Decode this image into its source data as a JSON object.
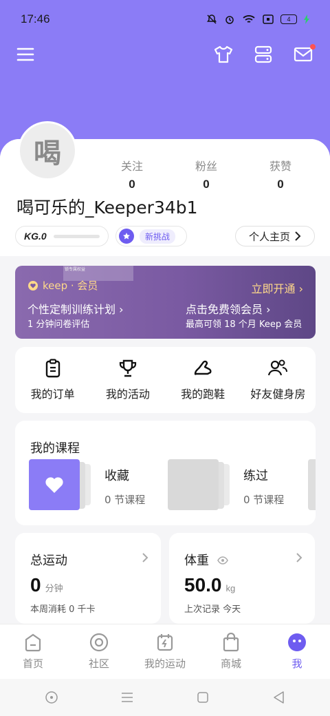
{
  "status": {
    "time": "17:46",
    "battery": "4"
  },
  "profile": {
    "avatar_char": "喝",
    "username": "喝可乐的_Keeper34b1",
    "stats": [
      {
        "label": "关注",
        "value": "0"
      },
      {
        "label": "粉丝",
        "value": "0"
      },
      {
        "label": "获赞",
        "value": "0"
      }
    ],
    "kg_level": "KG.0",
    "challenge_label": "新挑战",
    "home_button": "个人主页"
  },
  "vip": {
    "brand": "keep · 会员",
    "open_label": "立即开通",
    "item1_title": "个性定制训练计划",
    "item1_sub": "1 分钟问卷评估",
    "item2_title": "点击免费领会员",
    "item2_sub": "最高可领 18 个月 Keep 会员",
    "watermark": "这是提示中的内容，会员可提升并解锁专属权益"
  },
  "quick_links": [
    {
      "label": "我的订单",
      "icon": "clipboard-icon"
    },
    {
      "label": "我的活动",
      "icon": "trophy-icon"
    },
    {
      "label": "我的跑鞋",
      "icon": "shoe-icon"
    },
    {
      "label": "好友健身房",
      "icon": "friends-icon"
    }
  ],
  "courses": {
    "title": "我的课程",
    "items": [
      {
        "name": "收藏",
        "count": "0 节课程"
      },
      {
        "name": "练过",
        "count": "0 节课程"
      }
    ]
  },
  "total_exercise": {
    "title": "总运动",
    "value": "0",
    "unit": "分钟",
    "sub": "本周消耗 0 千卡"
  },
  "weight": {
    "title": "体重",
    "value": "50.0",
    "unit": "kg",
    "sub": "上次记录 今天"
  },
  "tabs": [
    {
      "label": "首页",
      "icon": "home-icon"
    },
    {
      "label": "社区",
      "icon": "community-icon"
    },
    {
      "label": "我的运动",
      "icon": "calendar-bolt-icon"
    },
    {
      "label": "商城",
      "icon": "shop-bag-icon"
    },
    {
      "label": "我",
      "icon": "me-icon",
      "active": true
    }
  ],
  "colors": {
    "header": "#8b7cf6",
    "accent": "#6e5cf0",
    "vip_gold": "#ffd98a"
  }
}
